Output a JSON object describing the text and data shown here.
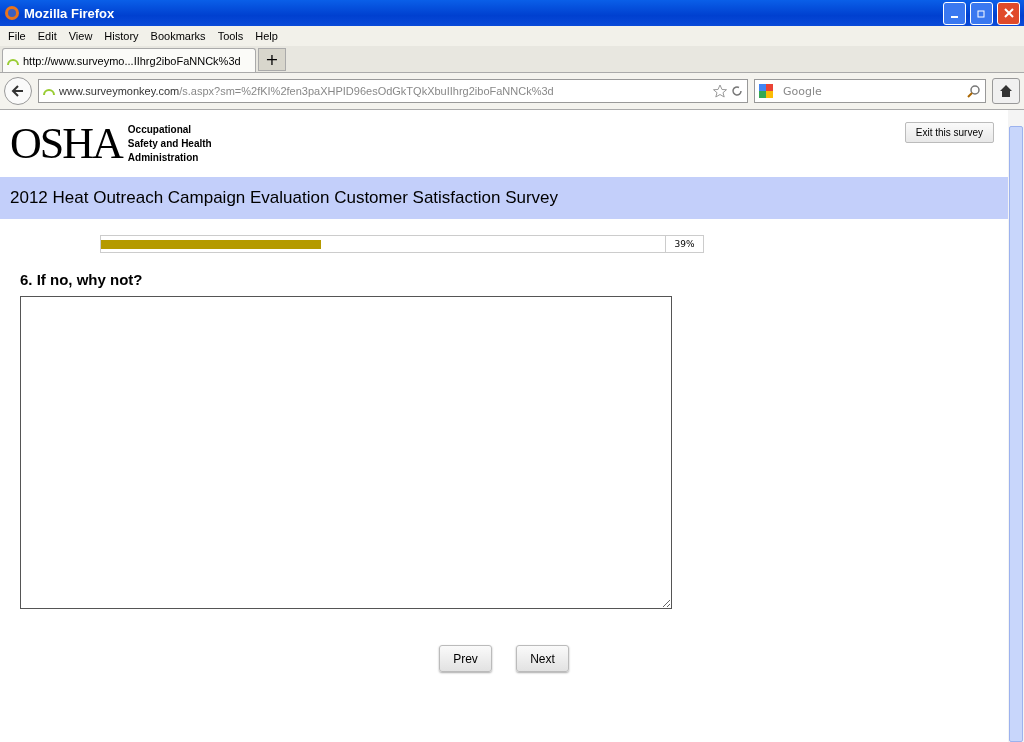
{
  "window": {
    "title": "Mozilla Firefox"
  },
  "menu": [
    "File",
    "Edit",
    "View",
    "History",
    "Bookmarks",
    "Tools",
    "Help"
  ],
  "tabs": [
    {
      "label": "http://www.surveymo...IIhrg2iboFaNNCk%3d",
      "selected": true
    }
  ],
  "new_tab": "+",
  "address": {
    "host": "www.surveymonkey.com",
    "path": "/s.aspx?sm=%2fKI%2fen3paXHPID96esOdGkTQkXbuIIhrg2iboFaNNCk%3d"
  },
  "search": {
    "placeholder": "Google"
  },
  "logo": {
    "mark": "OSHA",
    "lines": [
      "Occupational",
      "Safety and Health",
      "Administration"
    ]
  },
  "exit_button": "Exit this survey",
  "survey_title": "2012 Heat Outreach Campaign Evaluation Customer Satisfaction Survey",
  "progress": {
    "level": 0.39,
    "reading": "39%"
  },
  "question": "6. If no, why not?",
  "buttons": [
    "Prev",
    "Next"
  ]
}
